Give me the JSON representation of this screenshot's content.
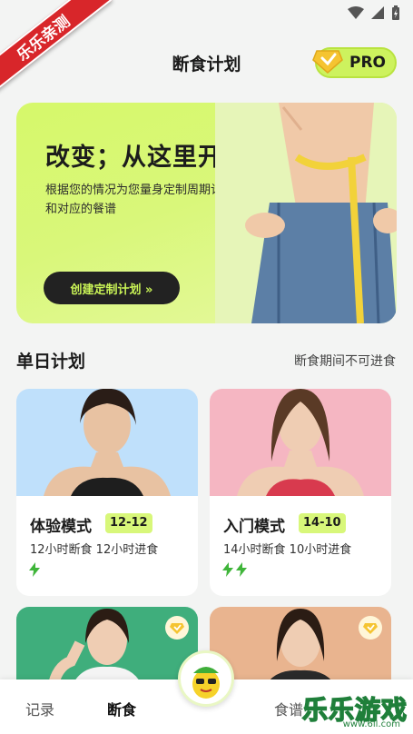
{
  "watermark_corner": "乐乐亲测",
  "header": {
    "title": "断食计划",
    "pro_label": "PRO"
  },
  "hero": {
    "title": "改变；从这里开始",
    "subtitle": "根据您的情况为您量身定制周期计划和对应的餐谱",
    "cta": "创建定制计划 »"
  },
  "section": {
    "title": "单日计划",
    "note": "断食期间不可进食"
  },
  "cards": [
    {
      "name": "体验模式",
      "tag": "12-12",
      "desc": "12小时断食 12小时进食",
      "bolts": 1,
      "photo_bg": "#bfe0fb"
    },
    {
      "name": "入门模式",
      "tag": "14-10",
      "desc": "14小时断食 10小时进食",
      "bolts": 2,
      "photo_bg": "#f5b6c2"
    }
  ],
  "cards_row2": [
    {
      "photo_bg": "#3fae7c",
      "premium": true
    },
    {
      "photo_bg": "#e9b48f",
      "premium": true
    }
  ],
  "nav": {
    "record": "记录",
    "fasting": "断食",
    "recipes": "食谱"
  },
  "watermark": {
    "text": "乐乐游戏",
    "url": "www.6ll.com"
  },
  "colors": {
    "accent": "#cdf25e",
    "dark": "#222222",
    "brand_red": "#d8262a"
  }
}
